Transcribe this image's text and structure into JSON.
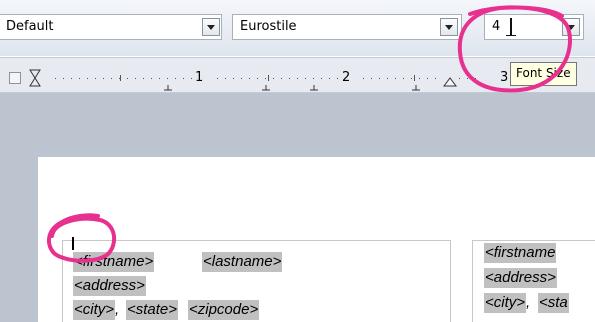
{
  "toolbar": {
    "paragraph_style": "Default",
    "font_name": "Eurostile",
    "font_size": "4"
  },
  "ruler": {
    "numbers": [
      "1",
      "2",
      "3"
    ]
  },
  "tooltip": {
    "text": "Font Size"
  },
  "document": {
    "fields": {
      "firstname": "<firstname>",
      "lastname": "<lastname>",
      "address": "<address>",
      "city": "<city>",
      "comma": ",",
      "state": "<state>",
      "zipcode": "<zipcode>",
      "firstname_2": "<firstname",
      "address_2": "<address>",
      "city_2": "<city>",
      "state_2": "<sta"
    }
  },
  "colors": {
    "annotation": "#e8318f",
    "field_shading": "#c0c0c0",
    "workspace": "#bcc4cf",
    "tooltip_bg": "#ffffe1"
  }
}
